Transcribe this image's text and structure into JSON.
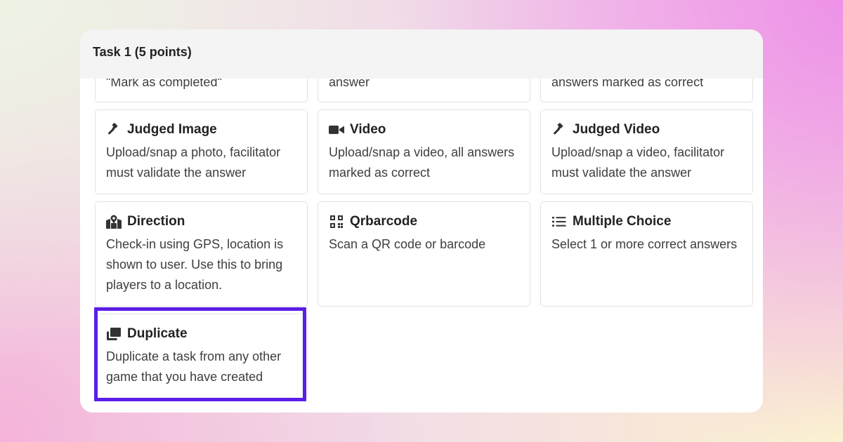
{
  "panel": {
    "title": "Task 1 (5 points)"
  },
  "partial_row": [
    {
      "desc": "\"Mark as completed\""
    },
    {
      "desc": "answer"
    },
    {
      "desc": "answers marked as correct"
    }
  ],
  "cards": [
    {
      "title": "Judged Image",
      "icon": "gavel-icon",
      "desc": "Upload/snap a photo, facilitator must validate the answer"
    },
    {
      "title": "Video",
      "icon": "video-camera-icon",
      "desc": "Upload/snap a video, all answers marked as correct"
    },
    {
      "title": "Judged Video",
      "icon": "gavel-icon",
      "desc": "Upload/snap a video, facilitator must validate the answer"
    },
    {
      "title": "Direction",
      "icon": "map-pin-icon",
      "desc": "Check-in using GPS, location is shown to user. Use this to bring players to a location."
    },
    {
      "title": "Qrbarcode",
      "icon": "qr-code-icon",
      "desc": "Scan a QR code or barcode"
    },
    {
      "title": "Multiple Choice",
      "icon": "list-icon",
      "desc": "Select 1 or more correct answers"
    },
    {
      "title": "Duplicate",
      "icon": "duplicate-icon",
      "desc": "Duplicate a task from any other game that you have created"
    }
  ],
  "highlight_color": "#5b1ee6"
}
